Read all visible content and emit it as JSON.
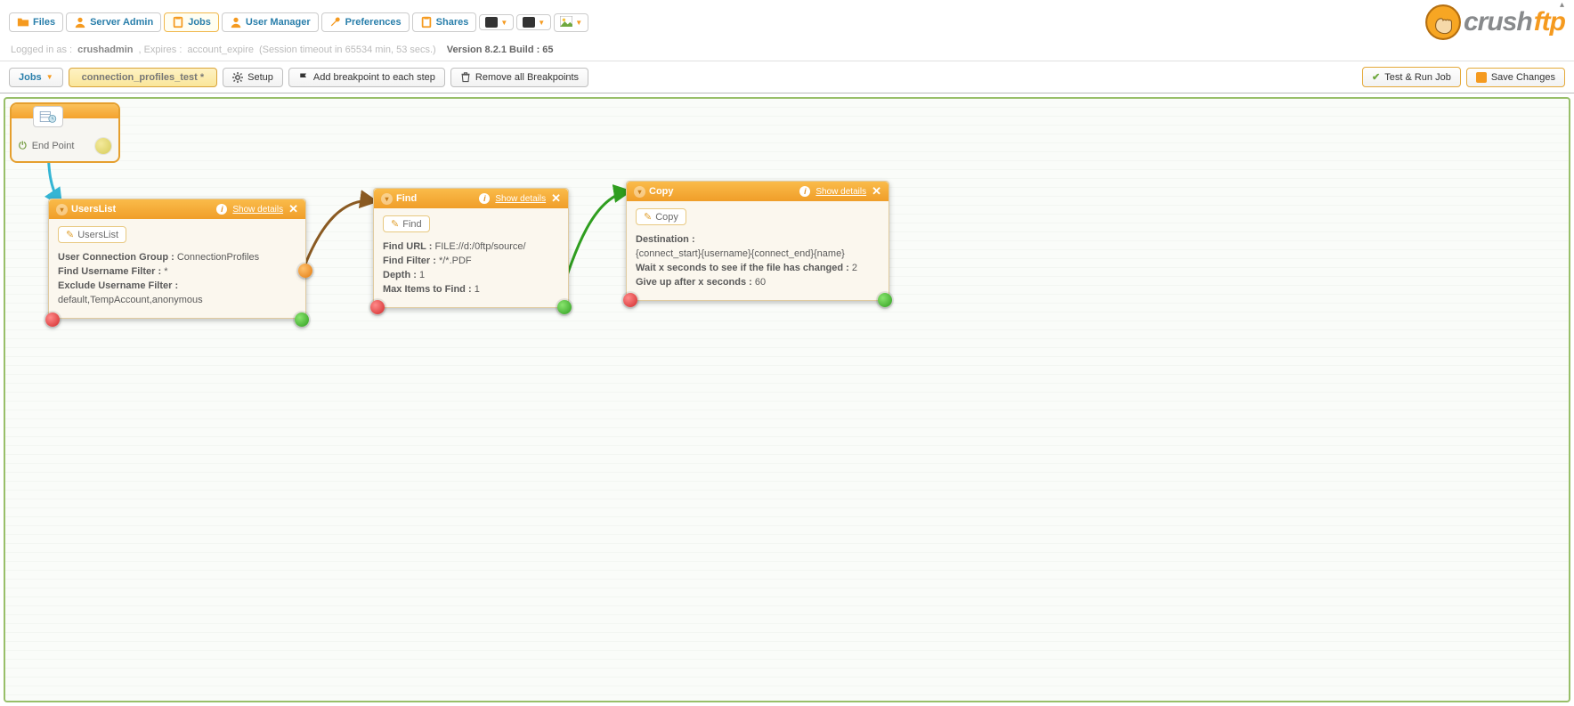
{
  "nav": {
    "files": "Files",
    "server_admin": "Server Admin",
    "jobs": "Jobs",
    "user_manager": "User Manager",
    "preferences": "Preferences",
    "shares": "Shares"
  },
  "status": {
    "logged_prefix": "Logged in as :",
    "user": "crushadmin",
    "expires_prefix": ", Expires :",
    "expires": "account_expire",
    "session": "(Session timeout in 65534 min, 53 secs.)",
    "version": "Version 8.2.1 Build : 65"
  },
  "toolbar": {
    "jobs_dd": "Jobs",
    "job_tab": "connection_profiles_test *",
    "setup": "Setup",
    "add_bp": "Add breakpoint to each step",
    "remove_bp": "Remove all Breakpoints",
    "test_run": "Test & Run Job",
    "save": "Save Changes"
  },
  "start": {
    "end_point": "End Point"
  },
  "cards": {
    "userslist": {
      "title": "UsersList",
      "show": "Show details",
      "pill": "UsersList",
      "rows": {
        "group_k": "User Connection Group :",
        "group_v": "ConnectionProfiles",
        "find_k": "Find Username Filter :",
        "find_v": "*",
        "excl_k": "Exclude Username Filter :",
        "excl_v": "default,TempAccount,anonymous"
      }
    },
    "find": {
      "title": "Find",
      "show": "Show details",
      "pill": "Find",
      "rows": {
        "url_k": "Find URL :",
        "url_v": "FILE://d:/0ftp/source/",
        "filter_k": "Find Filter :",
        "filter_v": "*/*.PDF",
        "depth_k": "Depth :",
        "depth_v": "1",
        "max_k": "Max Items to Find :",
        "max_v": "1"
      }
    },
    "copy": {
      "title": "Copy",
      "show": "Show details",
      "pill": "Copy",
      "rows": {
        "dest_k": "Destination :",
        "dest_v": "{connect_start}{username}{connect_end}{name}",
        "wait_k": "Wait x seconds to see if the file has changed :",
        "wait_v": "2",
        "give_k": "Give up after x seconds :",
        "give_v": "60"
      }
    }
  },
  "logo": {
    "t1": "crush",
    "t2": "ftp"
  }
}
